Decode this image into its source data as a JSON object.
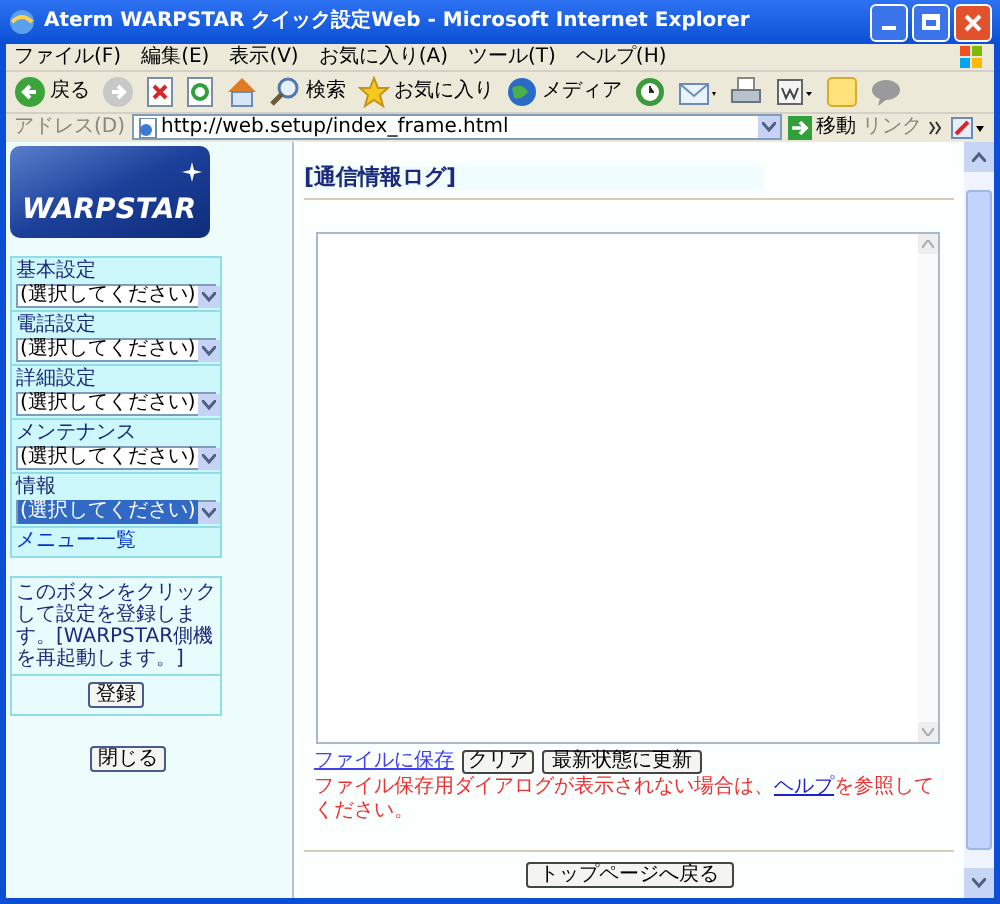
{
  "window": {
    "title": "Aterm WARPSTAR クイック設定Web - Microsoft Internet Explorer"
  },
  "menu_bar": [
    "ファイル(F)",
    "編集(E)",
    "表示(V)",
    "お気に入り(A)",
    "ツール(T)",
    "ヘルプ(H)"
  ],
  "toolbar": {
    "back": "戻る",
    "search": "検索",
    "favorites": "お気に入り",
    "media": "メディア"
  },
  "address_bar": {
    "label": "アドレス(D)",
    "value": "http://web.setup/index_frame.html",
    "go": "移動",
    "links": "リンク"
  },
  "sidebar": {
    "logo": "WARPSTAR",
    "groups": [
      {
        "label": "基本設定",
        "value": "(選択してください)",
        "focused": false
      },
      {
        "label": "電話設定",
        "value": "(選択してください)",
        "focused": false
      },
      {
        "label": "詳細設定",
        "value": "(選択してください)",
        "focused": false
      },
      {
        "label": "メンテナンス",
        "value": "(選択してください)",
        "focused": false
      },
      {
        "label": "情報",
        "value": "(選択してください)",
        "focused": true
      }
    ],
    "menu_link": "メニュー一覧",
    "note": "このボタンをクリックして設定を登録します。[WARPSTAR側機を再起動します。]",
    "register_button": "登録",
    "close_button": "閉じる"
  },
  "main": {
    "title": "[通信情報ログ]",
    "save_link": "ファイルに保存",
    "clear_button": "クリア",
    "refresh_button": "最新状態に更新",
    "notice": {
      "before": "ファイル保存用ダイアログが表示されない場合は、",
      "link": "ヘルプ",
      "after": "を参照してください。"
    },
    "top_button": "トップページへ戻る"
  }
}
